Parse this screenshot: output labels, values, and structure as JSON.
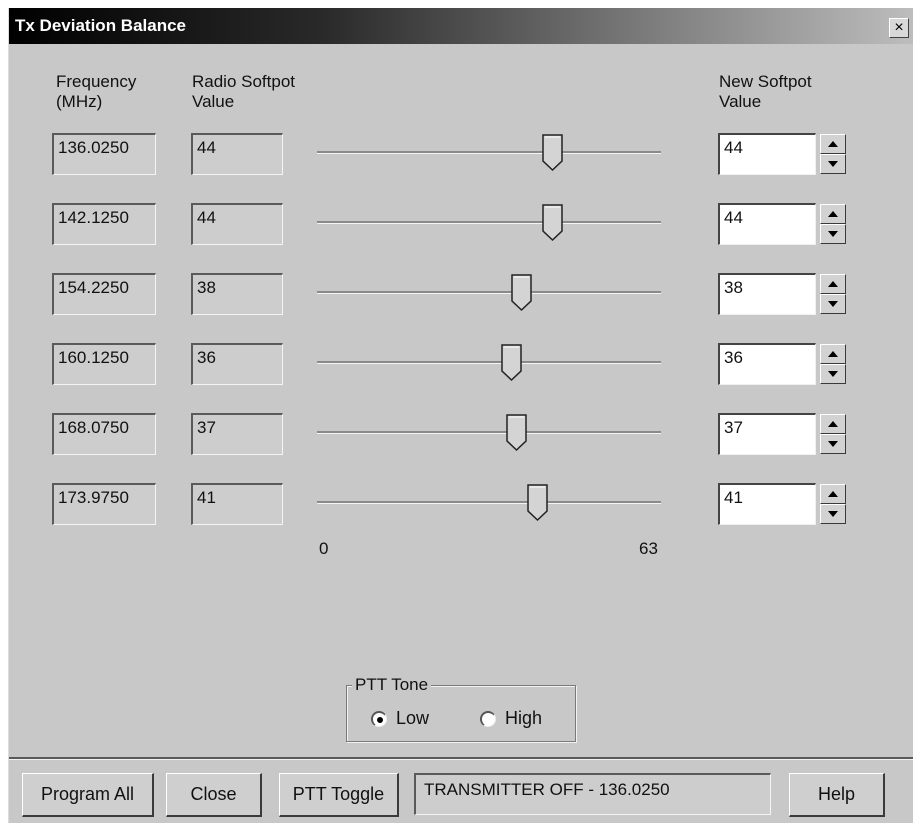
{
  "window": {
    "title": "Tx Deviation Balance",
    "close_label": "×"
  },
  "headers": {
    "frequency": "Frequency\n(MHz)",
    "radio_softpot": "Radio Softpot\nValue",
    "new_softpot": "New Softpot\nValue"
  },
  "slider_scale": {
    "min": 0,
    "max": 63,
    "min_label": "0",
    "max_label": "63"
  },
  "rows": [
    {
      "frequency": "136.0250",
      "radio_value": "44",
      "slider_value": 44,
      "new_value": "44"
    },
    {
      "frequency": "142.1250",
      "radio_value": "44",
      "slider_value": 44,
      "new_value": "44"
    },
    {
      "frequency": "154.2250",
      "radio_value": "38",
      "slider_value": 38,
      "new_value": "38"
    },
    {
      "frequency": "160.1250",
      "radio_value": "36",
      "slider_value": 36,
      "new_value": "36"
    },
    {
      "frequency": "168.0750",
      "radio_value": "37",
      "slider_value": 37,
      "new_value": "37"
    },
    {
      "frequency": "173.9750",
      "radio_value": "41",
      "slider_value": 41,
      "new_value": "41"
    }
  ],
  "ptt_tone": {
    "legend": "PTT Tone",
    "options": [
      {
        "label": "Low",
        "selected": true
      },
      {
        "label": "High",
        "selected": false
      }
    ]
  },
  "footer": {
    "program_all": "Program All",
    "close": "Close",
    "ptt_toggle": "PTT Toggle",
    "status": "TRANSMITTER OFF - 136.0250",
    "help": "Help"
  },
  "icons": {
    "spin_up": "spin-up-arrow-icon",
    "spin_down": "spin-down-arrow-icon",
    "slider_thumb": "slider-thumb-icon"
  }
}
